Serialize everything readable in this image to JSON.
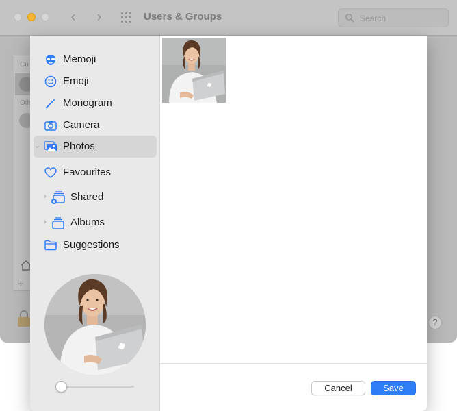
{
  "background_window": {
    "title": "Users & Groups",
    "search_placeholder": "Search",
    "list_label_current": "Cu",
    "list_label_other": "Oth",
    "add_symbol": "+",
    "help_symbol": "?"
  },
  "sidebar": {
    "items": [
      {
        "label": "Memoji",
        "icon": "memoji-icon",
        "selected": false
      },
      {
        "label": "Emoji",
        "icon": "emoji-icon",
        "selected": false
      },
      {
        "label": "Monogram",
        "icon": "monogram-pen-icon",
        "selected": false
      },
      {
        "label": "Camera",
        "icon": "camera-icon",
        "selected": false
      },
      {
        "label": "Photos",
        "icon": "photos-icon",
        "selected": true
      },
      {
        "label": "Favourites",
        "icon": "heart-icon",
        "selected": false
      },
      {
        "label": "Shared",
        "icon": "shared-albums-icon",
        "selected": false
      },
      {
        "label": "Albums",
        "icon": "albums-icon",
        "selected": false
      },
      {
        "label": "Suggestions",
        "icon": "folder-icon",
        "selected": false
      }
    ]
  },
  "zoom_slider": {
    "value": 0.0
  },
  "footer": {
    "cancel_label": "Cancel",
    "save_label": "Save"
  },
  "colors": {
    "accent": "#2f7df6",
    "icon_blue": "#2f7df6",
    "sidebar_bg": "#e9e9e9",
    "selected_bg": "#d6d6d6"
  }
}
